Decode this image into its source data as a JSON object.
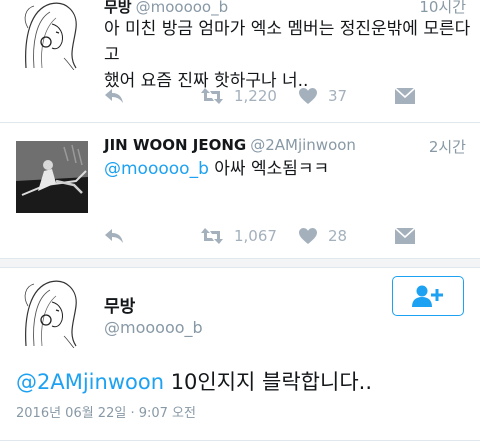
{
  "tweets": [
    {
      "name": "무방",
      "handle": "@mooooo_b",
      "time": "10시간",
      "text_line1": "아 미친 방금 엄마가 엑소 멤버는 정진운밖에 모른다고",
      "text_line2": "했어 요즘 진짜 핫하구나 너..",
      "retweets": "1,220",
      "likes": "37"
    },
    {
      "name": "JIN WOON JEONG",
      "handle": "@2AMjinwoon",
      "time": "2시간",
      "mention": "@mooooo_b",
      "text": " 아싸 엑소됨ㅋㅋ",
      "retweets": "1,067",
      "likes": "28"
    }
  ],
  "main_tweet": {
    "name": "무방",
    "handle": "@mooooo_b",
    "mention": "@2AMjinwoon",
    "text": " 10인지지 블락합니다..",
    "timestamp": "2016년 06월 22일 · 9:07 오전"
  },
  "icons": {
    "reply": "reply-icon",
    "retweet": "retweet-icon",
    "like": "heart-icon",
    "dm": "envelope-icon",
    "follow": "add-user-icon"
  },
  "colors": {
    "accent": "#1da1f2",
    "muted": "#8899a6",
    "action": "#a4b1bd"
  }
}
